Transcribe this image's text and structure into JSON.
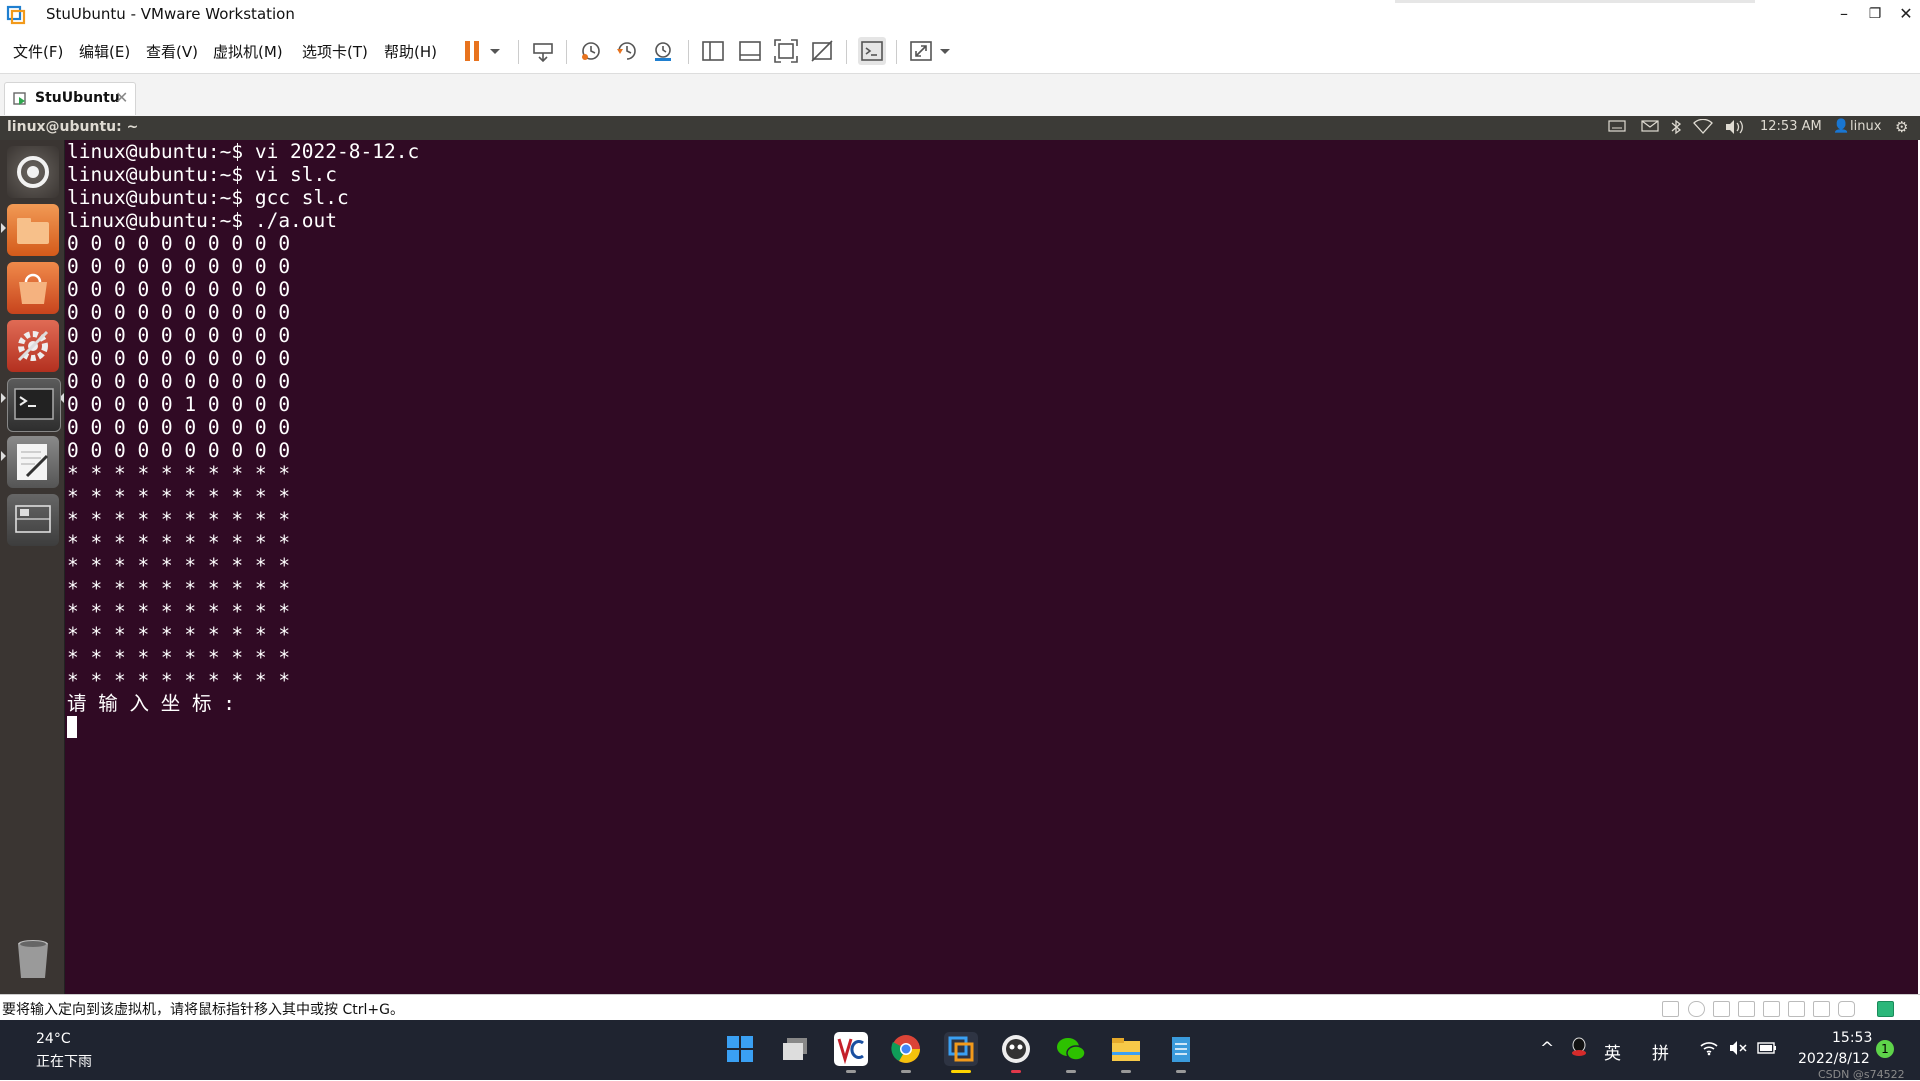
{
  "window": {
    "title": "StuUbuntu - VMware Workstation",
    "minimize_glyph": "–",
    "restore_glyph": "❐",
    "close_glyph": "✕"
  },
  "menu": {
    "items": [
      "文件(F)",
      "编辑(E)",
      "查看(V)",
      "虚拟机(M)",
      "选项卡(T)",
      "帮助(H)"
    ]
  },
  "toolbar": {
    "icons": [
      "pause-icon",
      "dropdown-icon",
      "send-ctrl-alt-del-icon",
      "snapshot-icon",
      "revert-snapshot-icon",
      "snapshot-manager-icon",
      "library-view-icon",
      "thumbnail-view-icon",
      "fullscreen-icon",
      "unity-icon",
      "console-view-icon",
      "stretch-guest-icon",
      "dropdown-icon"
    ]
  },
  "tabs": [
    {
      "label": "StuUbuntu",
      "close_glyph": "✕",
      "active": true
    }
  ],
  "ubuntu_panel": {
    "title": "linux@ubuntu: ~",
    "time": "12:53 AM",
    "user": "linux",
    "user_glyph": "👤",
    "gear_glyph": "⚙",
    "icons": [
      "keyboard-icon",
      "mail-icon",
      "bluetooth-icon",
      "network-icon",
      "volume-icon"
    ]
  },
  "launcher": {
    "items": [
      "dash-icon",
      "files-icon",
      "software-center-icon",
      "system-settings-icon",
      "terminal-icon",
      "text-editor-icon",
      "workspace-switcher-icon",
      "trash-icon"
    ]
  },
  "terminal": {
    "lines": [
      "linux@ubuntu:~$ vi 2022-8-12.c",
      "linux@ubuntu:~$ vi sl.c",
      "linux@ubuntu:~$ gcc sl.c",
      "linux@ubuntu:~$ ./a.out",
      "0 0 0 0 0 0 0 0 0 0",
      "0 0 0 0 0 0 0 0 0 0",
      "0 0 0 0 0 0 0 0 0 0",
      "0 0 0 0 0 0 0 0 0 0",
      "0 0 0 0 0 0 0 0 0 0",
      "0 0 0 0 0 0 0 0 0 0",
      "0 0 0 0 0 0 0 0 0 0",
      "0 0 0 0 0 1 0 0 0 0",
      "0 0 0 0 0 0 0 0 0 0",
      "0 0 0 0 0 0 0 0 0 0",
      "* * * * * * * * * *",
      "* * * * * * * * * *",
      "* * * * * * * * * *",
      "* * * * * * * * * *",
      "* * * * * * * * * *",
      "* * * * * * * * * *",
      "* * * * * * * * * *",
      "* * * * * * * * * *",
      "* * * * * * * * * *",
      "* * * * * * * * * *",
      "请 输 入 坐 标 :"
    ]
  },
  "statusbar": {
    "text": "要将输入定向到该虚拟机，请将鼠标指针移入其中或按 Ctrl+G。",
    "icons": [
      "hard-disk-icon",
      "cd-icon",
      "floppy-icon",
      "network-adapter-icon",
      "printer-icon",
      "usb-icon",
      "sound-icon",
      "camera-icon",
      "message-icon"
    ]
  },
  "taskbar": {
    "weather_temp": "24°C",
    "weather_desc": "正在下雨",
    "apps": [
      "windows-start-icon",
      "task-view-icon",
      "visual-c-icon",
      "chrome-icon",
      "vmware-icon",
      "qq-music-icon",
      "wechat-icon",
      "file-explorer-icon",
      "notepad-icon"
    ],
    "tray_chevron": "^",
    "lang": "英",
    "ime": "拼",
    "time": "15:53",
    "date": "2022/8/12",
    "notification_count": "1",
    "watermark": "CSDN @s74522"
  },
  "colors": {
    "terminal_bg": "#300a24",
    "ubuntu_panel": "#3c3b37",
    "launcher_bg": "#3a3532",
    "pause_orange": "#e8731e",
    "taskbar_bg": "#1f2430"
  }
}
